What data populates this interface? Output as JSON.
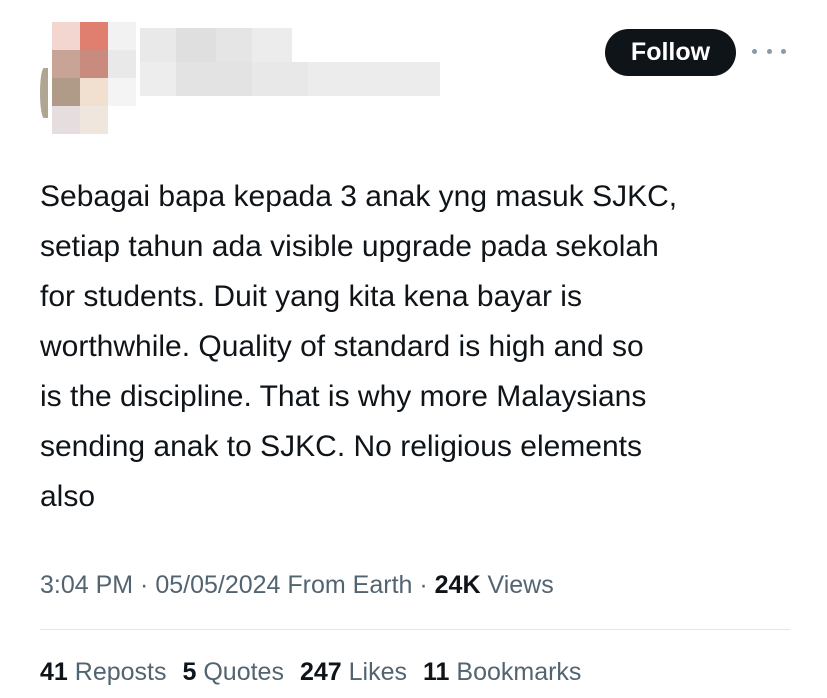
{
  "header": {
    "follow_label": "Follow",
    "more_icon": "more-horizontal-icon"
  },
  "tweet": {
    "text": "Sebagai bapa kepada 3 anak yng masuk SJKC,\nsetiap tahun ada visible upgrade pada sekolah\nfor students. Duit yang kita kena bayar is\nworthwhile. Quality of standard is high and so\nis the discipline. That is why more Malaysians\nsending anak to SJKC. No religious elements\nalso"
  },
  "meta": {
    "time": "3:04 PM",
    "separator": " · ",
    "date": "05/05/2024",
    "source": "From Earth",
    "views_count": "24K",
    "views_label": "Views"
  },
  "stats": {
    "reposts_count": "41",
    "reposts_label": "Reposts",
    "quotes_count": "5",
    "quotes_label": "Quotes",
    "likes_count": "247",
    "likes_label": "Likes",
    "bookmarks_count": "11",
    "bookmarks_label": "Bookmarks"
  },
  "colors": {
    "text_primary": "#0f1419",
    "text_secondary": "#536471",
    "button_bg": "#0f1419",
    "divider": "#e1e6ea"
  }
}
